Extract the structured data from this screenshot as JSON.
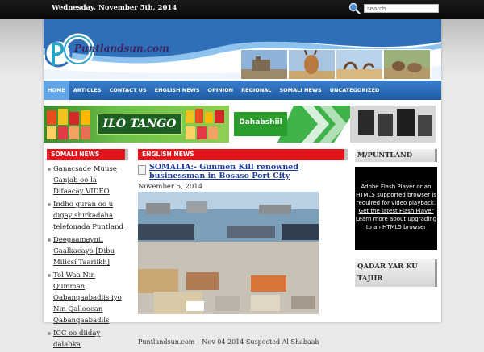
{
  "topbar": {
    "date": "Wednesday, November 5th, 2014",
    "search_placeholder": "search"
  },
  "header": {
    "logo_text": "Puntlandsun.com"
  },
  "nav": {
    "items": [
      "HOME",
      "ARTICLES",
      "CONTACT US",
      "ENGLISH NEWS",
      "OPINION",
      "REGIONAL",
      "SOMALI NEWS",
      "UNCATEGORIZED"
    ],
    "active_index": 0
  },
  "banner": {
    "left_text": "ILO TANGO",
    "right_text": "Dahabshiil"
  },
  "left_column": {
    "heading": "SOMALI NEWS",
    "items": [
      "Ganacsade Muuse Ganjab oo la Difaacay VIDEO",
      "Indho guran oo u digay shirkadaha telefonada Puntland",
      "Deegaamaynti Gaalkacayo [Dibu Milicsi Taariikh]",
      "Tol Waa Nin Qumman Qabanqaabadiis iyo Nin Qalloocan Qabanqaabadiis",
      "ICC oo diiday dalabka"
    ]
  },
  "middle_column": {
    "heading": "ENGLISH NEWS",
    "article_title": "SOMALIA:- Gunmen Kill renowned businessman in Bosaso Port City",
    "article_date": "November 5, 2014",
    "excerpt": "Puntlandsun.com – Nov 04 2014 Suspected Al Shabaab"
  },
  "right_column": {
    "heading1": "M/PUNTLAND",
    "flash_line1": "Adobe Flash Player or an HTML5 supported browser is required for video playback.",
    "flash_link1": "Get the latest Flash Player",
    "flash_link2": "Learn more about upgrading to an HTML5 browser",
    "heading2": "QADAR YAR KU TAJIIR"
  },
  "colors": {
    "nav_blue": "#1e5aa3",
    "nav_active": "#62a5e6",
    "section_red": "#e3141b",
    "link_blue": "#1a3a9a"
  }
}
